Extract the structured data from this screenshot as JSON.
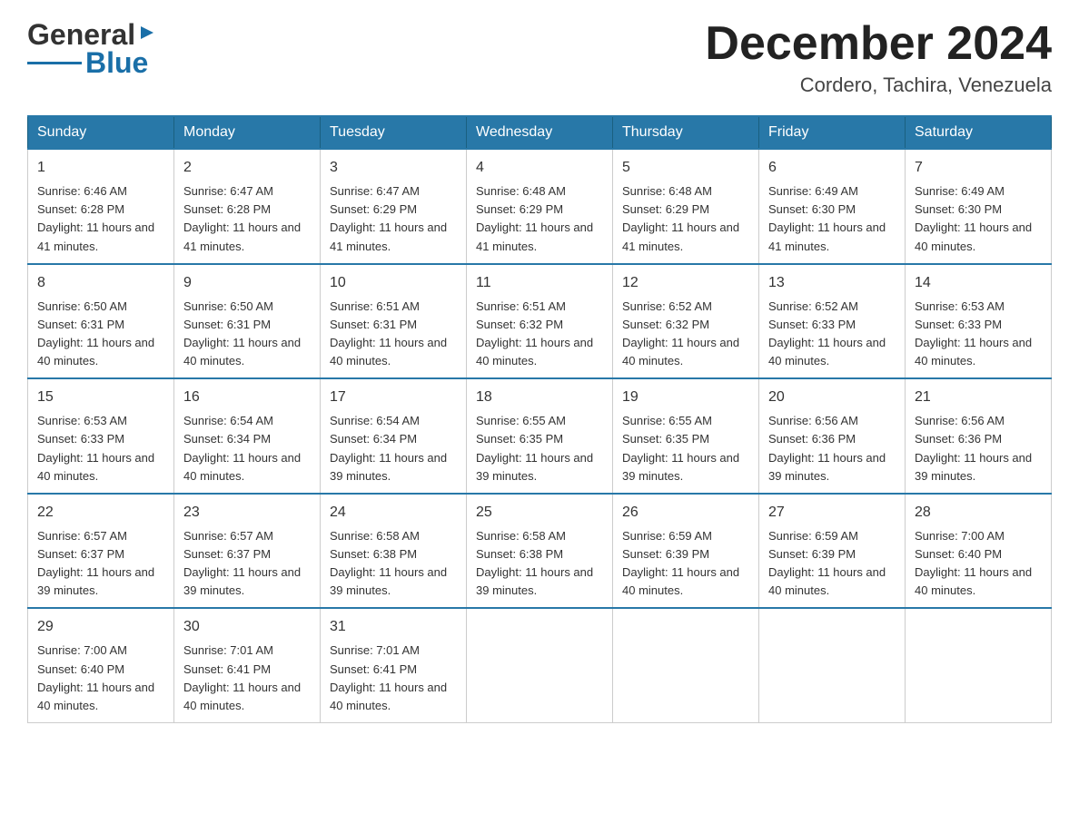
{
  "logo": {
    "text_general": "General",
    "text_blue": "Blue",
    "triangle_char": "▶"
  },
  "header": {
    "month_year": "December 2024",
    "location": "Cordero, Tachira, Venezuela"
  },
  "weekdays": [
    "Sunday",
    "Monday",
    "Tuesday",
    "Wednesday",
    "Thursday",
    "Friday",
    "Saturday"
  ],
  "weeks": [
    [
      {
        "day": "1",
        "sunrise": "6:46 AM",
        "sunset": "6:28 PM",
        "daylight": "11 hours and 41 minutes."
      },
      {
        "day": "2",
        "sunrise": "6:47 AM",
        "sunset": "6:28 PM",
        "daylight": "11 hours and 41 minutes."
      },
      {
        "day": "3",
        "sunrise": "6:47 AM",
        "sunset": "6:29 PM",
        "daylight": "11 hours and 41 minutes."
      },
      {
        "day": "4",
        "sunrise": "6:48 AM",
        "sunset": "6:29 PM",
        "daylight": "11 hours and 41 minutes."
      },
      {
        "day": "5",
        "sunrise": "6:48 AM",
        "sunset": "6:29 PM",
        "daylight": "11 hours and 41 minutes."
      },
      {
        "day": "6",
        "sunrise": "6:49 AM",
        "sunset": "6:30 PM",
        "daylight": "11 hours and 41 minutes."
      },
      {
        "day": "7",
        "sunrise": "6:49 AM",
        "sunset": "6:30 PM",
        "daylight": "11 hours and 40 minutes."
      }
    ],
    [
      {
        "day": "8",
        "sunrise": "6:50 AM",
        "sunset": "6:31 PM",
        "daylight": "11 hours and 40 minutes."
      },
      {
        "day": "9",
        "sunrise": "6:50 AM",
        "sunset": "6:31 PM",
        "daylight": "11 hours and 40 minutes."
      },
      {
        "day": "10",
        "sunrise": "6:51 AM",
        "sunset": "6:31 PM",
        "daylight": "11 hours and 40 minutes."
      },
      {
        "day": "11",
        "sunrise": "6:51 AM",
        "sunset": "6:32 PM",
        "daylight": "11 hours and 40 minutes."
      },
      {
        "day": "12",
        "sunrise": "6:52 AM",
        "sunset": "6:32 PM",
        "daylight": "11 hours and 40 minutes."
      },
      {
        "day": "13",
        "sunrise": "6:52 AM",
        "sunset": "6:33 PM",
        "daylight": "11 hours and 40 minutes."
      },
      {
        "day": "14",
        "sunrise": "6:53 AM",
        "sunset": "6:33 PM",
        "daylight": "11 hours and 40 minutes."
      }
    ],
    [
      {
        "day": "15",
        "sunrise": "6:53 AM",
        "sunset": "6:33 PM",
        "daylight": "11 hours and 40 minutes."
      },
      {
        "day": "16",
        "sunrise": "6:54 AM",
        "sunset": "6:34 PM",
        "daylight": "11 hours and 40 minutes."
      },
      {
        "day": "17",
        "sunrise": "6:54 AM",
        "sunset": "6:34 PM",
        "daylight": "11 hours and 39 minutes."
      },
      {
        "day": "18",
        "sunrise": "6:55 AM",
        "sunset": "6:35 PM",
        "daylight": "11 hours and 39 minutes."
      },
      {
        "day": "19",
        "sunrise": "6:55 AM",
        "sunset": "6:35 PM",
        "daylight": "11 hours and 39 minutes."
      },
      {
        "day": "20",
        "sunrise": "6:56 AM",
        "sunset": "6:36 PM",
        "daylight": "11 hours and 39 minutes."
      },
      {
        "day": "21",
        "sunrise": "6:56 AM",
        "sunset": "6:36 PM",
        "daylight": "11 hours and 39 minutes."
      }
    ],
    [
      {
        "day": "22",
        "sunrise": "6:57 AM",
        "sunset": "6:37 PM",
        "daylight": "11 hours and 39 minutes."
      },
      {
        "day": "23",
        "sunrise": "6:57 AM",
        "sunset": "6:37 PM",
        "daylight": "11 hours and 39 minutes."
      },
      {
        "day": "24",
        "sunrise": "6:58 AM",
        "sunset": "6:38 PM",
        "daylight": "11 hours and 39 minutes."
      },
      {
        "day": "25",
        "sunrise": "6:58 AM",
        "sunset": "6:38 PM",
        "daylight": "11 hours and 39 minutes."
      },
      {
        "day": "26",
        "sunrise": "6:59 AM",
        "sunset": "6:39 PM",
        "daylight": "11 hours and 40 minutes."
      },
      {
        "day": "27",
        "sunrise": "6:59 AM",
        "sunset": "6:39 PM",
        "daylight": "11 hours and 40 minutes."
      },
      {
        "day": "28",
        "sunrise": "7:00 AM",
        "sunset": "6:40 PM",
        "daylight": "11 hours and 40 minutes."
      }
    ],
    [
      {
        "day": "29",
        "sunrise": "7:00 AM",
        "sunset": "6:40 PM",
        "daylight": "11 hours and 40 minutes."
      },
      {
        "day": "30",
        "sunrise": "7:01 AM",
        "sunset": "6:41 PM",
        "daylight": "11 hours and 40 minutes."
      },
      {
        "day": "31",
        "sunrise": "7:01 AM",
        "sunset": "6:41 PM",
        "daylight": "11 hours and 40 minutes."
      },
      null,
      null,
      null,
      null
    ]
  ]
}
